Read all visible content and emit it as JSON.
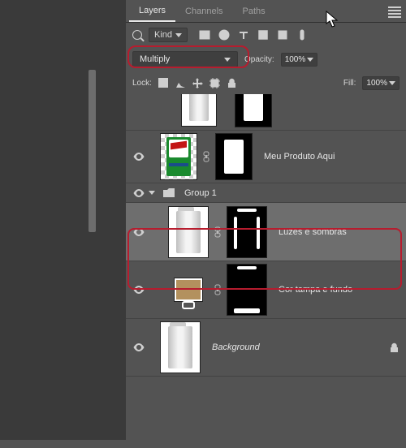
{
  "tabs": {
    "layers": "Layers",
    "channels": "Channels",
    "paths": "Paths"
  },
  "filter": {
    "kind": "Kind"
  },
  "blend": {
    "mode": "Multiply",
    "opacity_label": "Opacity:",
    "opacity_value": "100%"
  },
  "lock": {
    "label": "Lock:",
    "fill_label": "Fill:",
    "fill_value": "100%"
  },
  "layers": {
    "product": "Meu Produto Aqui",
    "group1": "Group 1",
    "luzes": "Luzes e sombras",
    "tampa": "Cor tampa e fundo",
    "bg": "Background"
  }
}
